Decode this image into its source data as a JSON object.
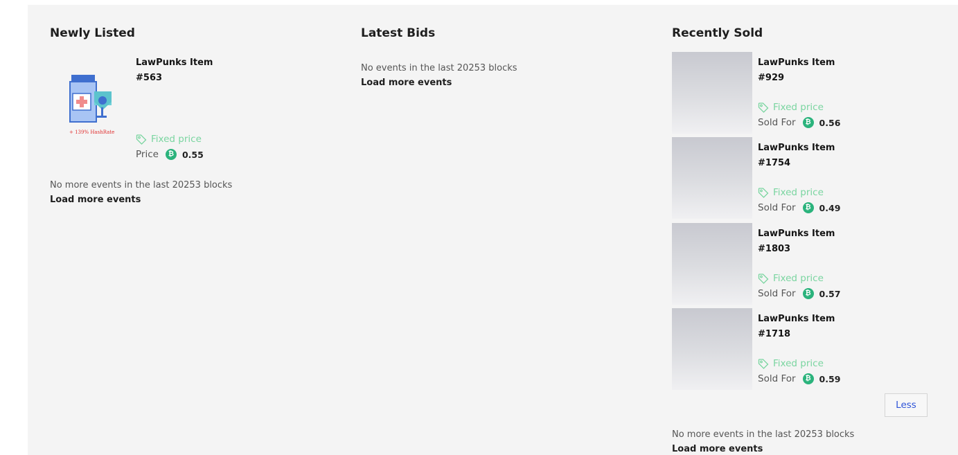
{
  "newly_listed": {
    "title": "Newly Listed",
    "items": [
      {
        "name_line1": "LawPunks Item",
        "name_line2": "#563",
        "price_type": "Fixed price",
        "price_label": "Price",
        "price": "0.55",
        "image_caption": "+ 139% HashRate"
      }
    ],
    "note": "No more events in the last 20253 blocks",
    "load_more": "Load more events"
  },
  "latest_bids": {
    "title": "Latest Bids",
    "note": "No events in the last 20253 blocks",
    "load_more": "Load more events"
  },
  "recently_sold": {
    "title": "Recently Sold",
    "items": [
      {
        "name_line1": "LawPunks Item",
        "name_line2": "#929",
        "price_type": "Fixed price",
        "price_label": "Sold For",
        "price": "0.56"
      },
      {
        "name_line1": "LawPunks Item",
        "name_line2": "#1754",
        "price_type": "Fixed price",
        "price_label": "Sold For",
        "price": "0.49"
      },
      {
        "name_line1": "LawPunks Item",
        "name_line2": "#1803",
        "price_type": "Fixed price",
        "price_label": "Sold For",
        "price": "0.57"
      },
      {
        "name_line1": "LawPunks Item",
        "name_line2": "#1718",
        "price_type": "Fixed price",
        "price_label": "Sold For",
        "price": "0.59"
      }
    ],
    "less_button": "Less",
    "note": "No more events in the last 20253 blocks",
    "load_more": "Load more events"
  },
  "coin_icon": "bitcoin-icon",
  "colors": {
    "accent_green": "#2bb37c",
    "fixed_price": "#7ad5a0",
    "link_blue": "#2f54d8"
  }
}
